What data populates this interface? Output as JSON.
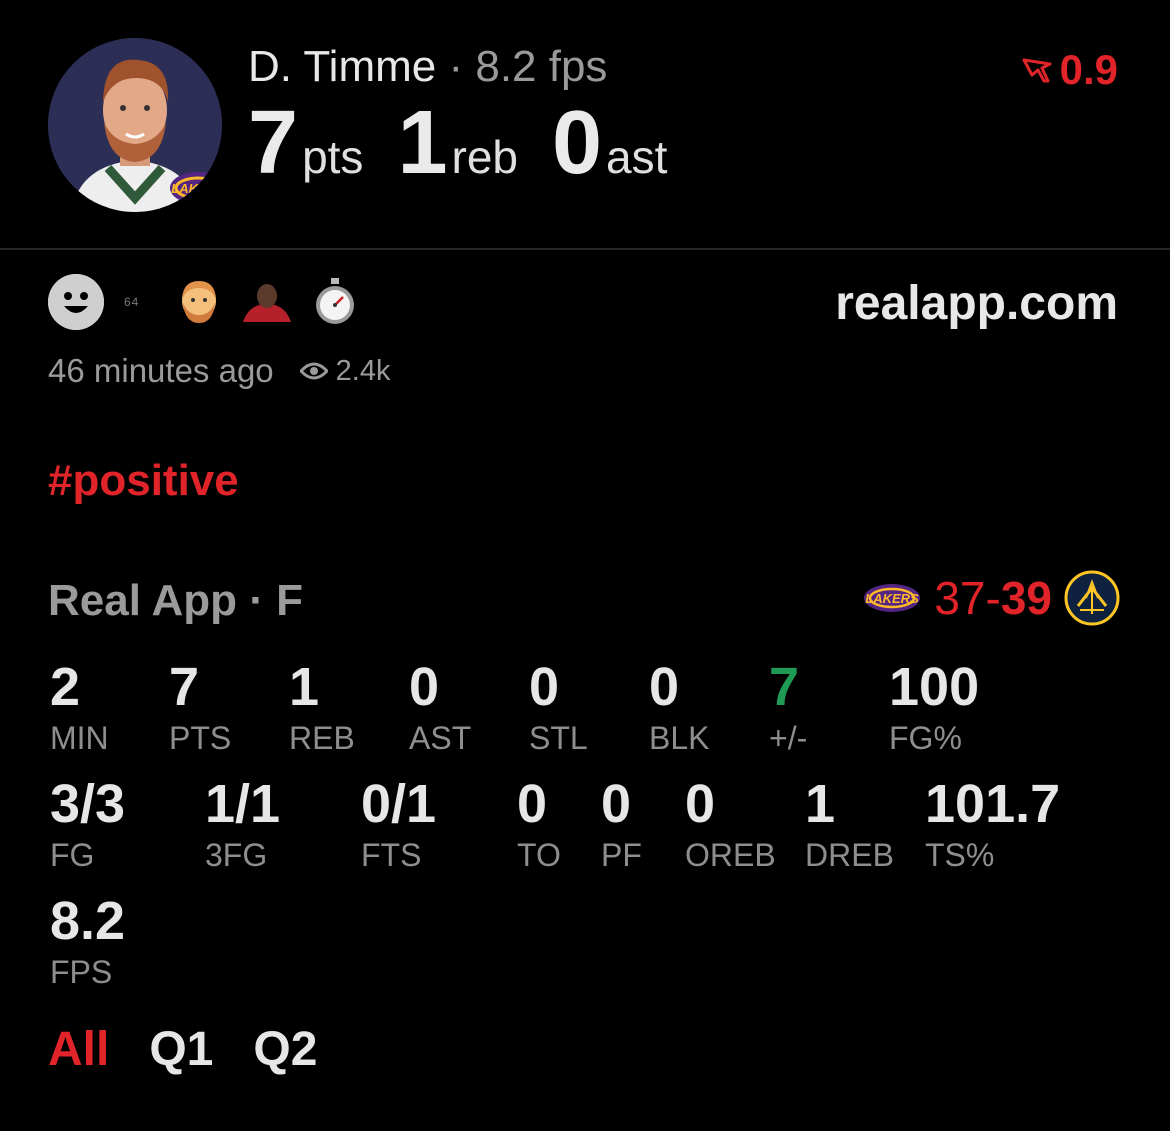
{
  "header": {
    "player_name": "D. Timme",
    "separator": " · ",
    "fps_text": "8.2 fps",
    "pts_value": "7",
    "pts_unit": "pts",
    "reb_value": "1",
    "reb_unit": "reb",
    "ast_value": "0",
    "ast_unit": "ast",
    "rating": "0.9",
    "team_logo_text": "LAKERS"
  },
  "post": {
    "reaction_count": "64",
    "site": "realapp.com",
    "time_ago": "46 minutes ago",
    "views": "2.4k",
    "hashtag": "#positive"
  },
  "game": {
    "title": "Real App · F",
    "home_score": "37",
    "score_separator": "-",
    "away_score": "39",
    "home_logo_text": "LAKERS"
  },
  "stats_row1": [
    {
      "value": "2",
      "label": "MIN"
    },
    {
      "value": "7",
      "label": "PTS"
    },
    {
      "value": "1",
      "label": "REB"
    },
    {
      "value": "0",
      "label": "AST"
    },
    {
      "value": "0",
      "label": "STL"
    },
    {
      "value": "0",
      "label": "BLK"
    },
    {
      "value": "7",
      "label": "+/-"
    },
    {
      "value": "100",
      "label": "FG%"
    }
  ],
  "stats_row2": [
    {
      "value": "3/3",
      "label": "FG"
    },
    {
      "value": "1/1",
      "label": "3FG"
    },
    {
      "value": "0/1",
      "label": "FTS"
    },
    {
      "value": "0",
      "label": "TO"
    },
    {
      "value": "0",
      "label": "PF"
    },
    {
      "value": "0",
      "label": "OREB"
    },
    {
      "value": "1",
      "label": "DREB"
    },
    {
      "value": "101.7",
      "label": "TS%"
    }
  ],
  "stats_row3": [
    {
      "value": "8.2",
      "label": "FPS"
    }
  ],
  "tabs": [
    "All",
    "Q1",
    "Q2"
  ],
  "colors": {
    "accent_red": "#e0242a",
    "positive_green": "#1f9a55",
    "lakers_purple": "#552583",
    "lakers_gold": "#fdb927",
    "background": "#000000"
  }
}
